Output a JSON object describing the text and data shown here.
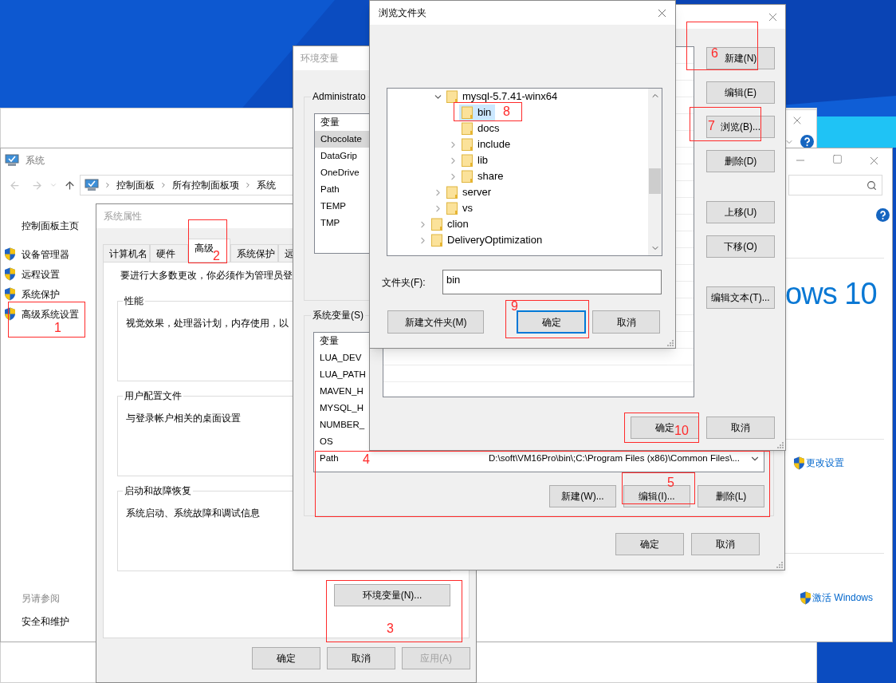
{
  "system_window": {
    "title": "系统",
    "breadcrumb": [
      "控制面板",
      "所有控制面板项",
      "系统"
    ],
    "sidebar_home": "控制面板主页",
    "sidebar_links": [
      "设备管理器",
      "远程设置",
      "系统保护",
      "高级系统设置"
    ],
    "see_also_heading": "另请参阅",
    "see_also_links": [
      "安全和维护"
    ],
    "logo_text": "ows 10",
    "change_settings": "更改设置",
    "activate": "激活 Windows"
  },
  "system_properties": {
    "title": "系统属性",
    "tabs": [
      {
        "label": "计算机名",
        "selected": false
      },
      {
        "label": "硬件",
        "selected": false
      },
      {
        "label": "高级",
        "selected": true
      },
      {
        "label": "系统保护",
        "selected": false
      },
      {
        "label": "远",
        "selected": false
      }
    ],
    "notice": "要进行大多数更改，你必须作为管理员登",
    "groups": [
      {
        "title": "性能",
        "description": "视觉效果，处理器计划，内存使用，以"
      },
      {
        "title": "用户配置文件",
        "description": "与登录帐户相关的桌面设置"
      },
      {
        "title": "启动和故障恢复",
        "description": "系统启动、系统故障和调试信息"
      }
    ],
    "env_button": "环境变量(N)...",
    "buttons": [
      {
        "label": "确定",
        "disabled": false
      },
      {
        "label": "取消",
        "disabled": false
      },
      {
        "label": "应用(A)",
        "disabled": true
      }
    ]
  },
  "environment_variables": {
    "title": "环境变量",
    "user_group": "Administrato",
    "user_list_header": "变量",
    "user_variables": [
      {
        "name": "Chocolate",
        "selected": true
      },
      {
        "name": "DataGrip",
        "selected": false
      },
      {
        "name": "OneDrive",
        "selected": false
      },
      {
        "name": "Path",
        "selected": false
      },
      {
        "name": "TEMP",
        "selected": false
      },
      {
        "name": "TMP",
        "selected": false
      }
    ],
    "system_group": "系统变量(S)",
    "system_list_header": "变量",
    "system_variables": [
      {
        "name": "LUA_DEV"
      },
      {
        "name": "LUA_PATH"
      },
      {
        "name": "MAVEN_H"
      },
      {
        "name": "MYSQL_H"
      },
      {
        "name": "NUMBER_"
      },
      {
        "name": "OS"
      },
      {
        "name": "Path",
        "value": "D:\\soft\\VM16Pro\\bin\\;C:\\Program Files (x86)\\Common Files\\..."
      }
    ],
    "system_buttons": [
      "新建(W)...",
      "编辑(I)...",
      "删除(L)"
    ],
    "buttons": [
      "确定",
      "取消"
    ]
  },
  "edit_path": {
    "side_buttons": [
      "新建(N)",
      "编辑(E)",
      "浏览(B)...",
      "删除(D)",
      "上移(U)",
      "下移(O)",
      "编辑文本(T)..."
    ],
    "buttons": [
      "确定",
      "取消"
    ]
  },
  "browse_folder": {
    "title": "浏览文件夹",
    "tree": [
      {
        "children": [
          {
            "name": "mysql-5.7.41-winx64",
            "expanded": true,
            "selected": false,
            "children": [
              {
                "name": "bin",
                "selected": true
              },
              {
                "name": "docs",
                "selected": false
              },
              {
                "name": "include",
                "expanded": false,
                "selected": false
              },
              {
                "name": "lib",
                "expanded": false,
                "selected": false
              },
              {
                "name": "share",
                "expanded": false,
                "selected": false
              }
            ]
          },
          {
            "name": "server",
            "expanded": false,
            "selected": false
          },
          {
            "name": "vs",
            "expanded": false,
            "selected": false
          }
        ]
      },
      {
        "name": "clion",
        "expanded": false,
        "selected": false
      },
      {
        "name": "DeliveryOptimization",
        "expanded": false,
        "selected": false
      }
    ],
    "folder_label": "文件夹(F):",
    "folder_value": "bin",
    "buttons": [
      {
        "label": "新建文件夹(M)",
        "focused": false
      },
      {
        "label": "确定",
        "focused": true
      },
      {
        "label": "取消",
        "focused": false
      }
    ]
  },
  "annotations": [
    {
      "label": "1"
    },
    {
      "label": "2"
    },
    {
      "label": "3"
    },
    {
      "label": "4"
    },
    {
      "label": "5"
    },
    {
      "label": "6"
    },
    {
      "label": "7"
    },
    {
      "label": "8"
    },
    {
      "label": "9"
    },
    {
      "label": "10"
    }
  ]
}
